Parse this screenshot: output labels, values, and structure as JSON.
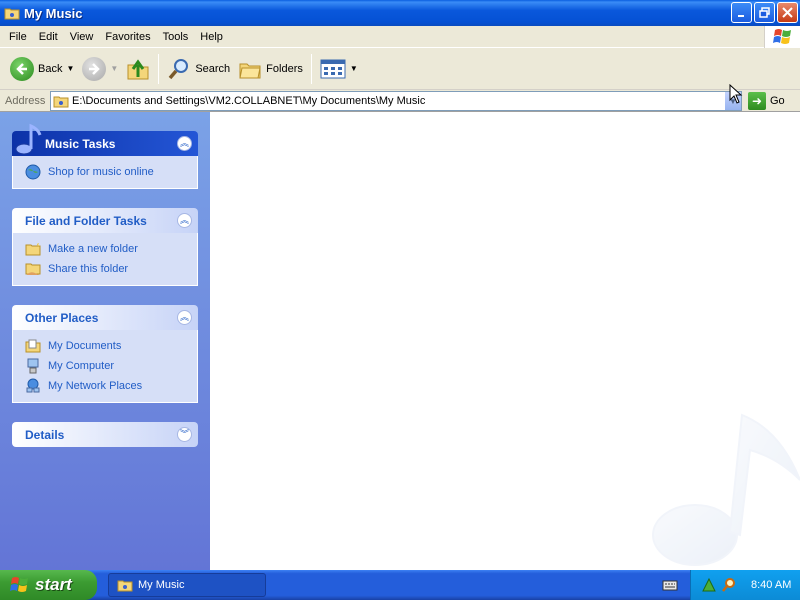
{
  "window": {
    "title": "My Music",
    "controls": {
      "minimize": "minimize",
      "restore": "restore",
      "close": "close"
    }
  },
  "menubar": {
    "items": [
      "File",
      "Edit",
      "View",
      "Favorites",
      "Tools",
      "Help"
    ]
  },
  "toolbar": {
    "back_label": "Back",
    "search_label": "Search",
    "folders_label": "Folders"
  },
  "address": {
    "label": "Address",
    "path": "E:\\Documents and Settings\\VM2.COLLABNET\\My Documents\\My Music",
    "go_label": "Go"
  },
  "taskpane": {
    "music_tasks": {
      "title": "Music Tasks",
      "items": [
        "Shop for music online"
      ]
    },
    "file_folder_tasks": {
      "title": "File and Folder Tasks",
      "items": [
        "Make a new folder",
        "Share this folder"
      ]
    },
    "other_places": {
      "title": "Other Places",
      "items": [
        "My Documents",
        "My Computer",
        "My Network Places"
      ]
    },
    "details": {
      "title": "Details"
    }
  },
  "taskbar": {
    "start_label": "start",
    "open_window": "My Music",
    "clock": "8:40 AM"
  },
  "colors": {
    "titlebar": "#0a58dc",
    "taskpane": "#7ba2e7",
    "link": "#215dc6",
    "start": "#3c9c32"
  }
}
